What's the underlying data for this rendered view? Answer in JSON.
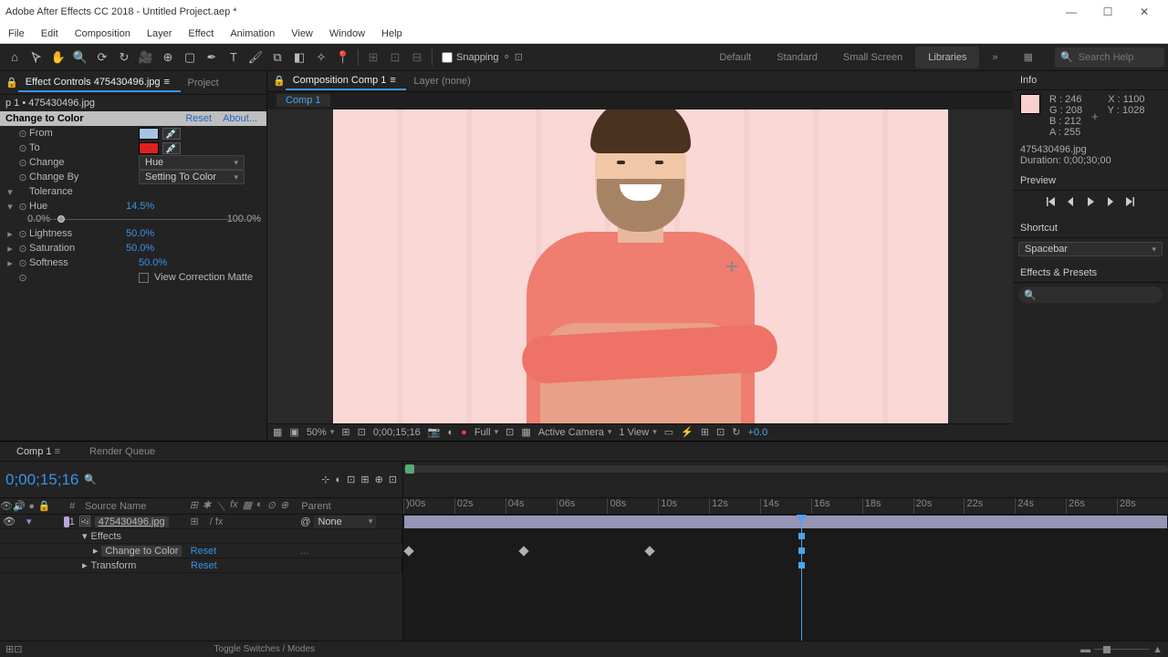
{
  "window": {
    "title": "Adobe After Effects CC 2018 - Untitled Project.aep *"
  },
  "menu": {
    "file": "File",
    "edit": "Edit",
    "composition": "Composition",
    "layer": "Layer",
    "effect": "Effect",
    "animation": "Animation",
    "view": "View",
    "window": "Window",
    "help": "Help"
  },
  "toolbar": {
    "snapping": "Snapping",
    "default": "Default",
    "standard": "Standard",
    "smallscreen": "Small Screen",
    "libraries": "Libraries",
    "search_ph": "Search Help"
  },
  "ec": {
    "tab": "Effect Controls 475430496.jpg",
    "project": "Project",
    "header": "p 1 • 475430496.jpg",
    "effect_name": "Change to Color",
    "reset": "Reset",
    "about": "About...",
    "from": "From",
    "to": "To",
    "change": "Change",
    "change_val": "Hue",
    "change_by": "Change By",
    "change_by_val": "Setting To Color",
    "tolerance": "Tolerance",
    "hue": "Hue",
    "hue_val": "14.5%",
    "hue_min": "0.0%",
    "hue_max": "100.0%",
    "lightness": "Lightness",
    "lightness_val": "50.0%",
    "saturation": "Saturation",
    "saturation_val": "50.0%",
    "softness": "Softness",
    "softness_val": "50.0%",
    "vcm": "View Correction Matte",
    "from_color": "#a8c4e0",
    "to_color": "#e02020"
  },
  "comp": {
    "tab": "Composition Comp 1",
    "layer_tab": "Layer (none)",
    "subtab": "Comp 1",
    "zoom": "50%",
    "time": "0;00;15;16",
    "res": "Full",
    "camera": "Active Camera",
    "view": "1 View",
    "exposure": "+0.0"
  },
  "right": {
    "info": "Info",
    "r": "R : 246",
    "g": "G : 208",
    "b": "B : 212",
    "a": "A : 255",
    "x": "X : 1100",
    "y": "Y : 1028",
    "file": "475430496.jpg",
    "duration": "Duration: 0;00;30;00",
    "preview": "Preview",
    "shortcut": "Shortcut",
    "shortcut_val": "Spacebar",
    "ep": "Effects & Presets"
  },
  "timeline": {
    "tab": "Comp 1",
    "rq": "Render Queue",
    "timecode": "0;00;15;16",
    "col_num": "#",
    "col_src": "Source Name",
    "col_par": "Parent",
    "layer_num": "1",
    "layer_name": "475430496.jpg",
    "parent_val": "None",
    "effects": "Effects",
    "ctc": "Change to Color",
    "ctc_reset": "Reset",
    "transform": "Transform",
    "tr_reset": "Reset",
    "toggle": "Toggle Switches / Modes",
    "ticks": [
      ")00s",
      "02s",
      "04s",
      "06s",
      "08s",
      "10s",
      "12s",
      "14s",
      "16s",
      "18s",
      "20s",
      "22s",
      "24s",
      "26s",
      "28s"
    ]
  }
}
